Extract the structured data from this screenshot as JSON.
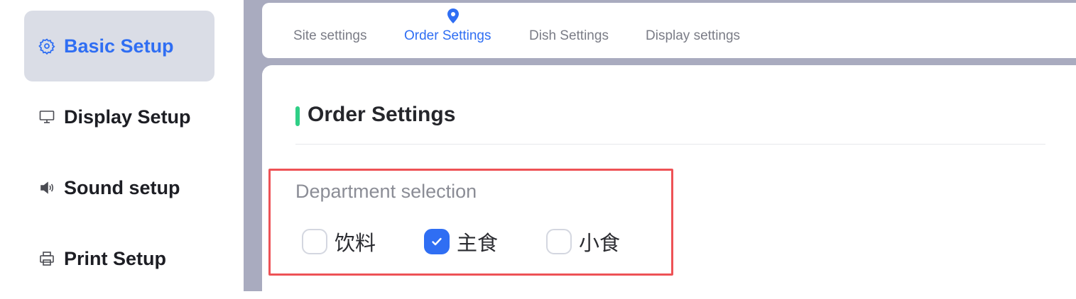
{
  "sidebar": {
    "items": [
      {
        "label": "Basic Setup",
        "icon": "gear-icon",
        "active": true
      },
      {
        "label": "Display Setup",
        "icon": "monitor-icon",
        "active": false
      },
      {
        "label": "Sound setup",
        "icon": "speaker-icon",
        "active": false
      },
      {
        "label": "Print Setup",
        "icon": "printer-icon",
        "active": false
      }
    ]
  },
  "tabs": {
    "items": [
      {
        "label": "Site settings",
        "active": false
      },
      {
        "label": "Order Settings",
        "active": true
      },
      {
        "label": "Dish Settings",
        "active": false
      },
      {
        "label": "Display settings",
        "active": false
      }
    ],
    "active_indicator_icon": "location-pin-icon"
  },
  "section": {
    "title": "Order Settings"
  },
  "department": {
    "label": "Department selection",
    "options": [
      {
        "label": "饮料",
        "checked": false
      },
      {
        "label": "主食",
        "checked": true
      },
      {
        "label": "小食",
        "checked": false
      }
    ]
  },
  "colors": {
    "accent": "#2f6ef3",
    "section_accent": "#2fcf86",
    "highlight_border": "#ee5256",
    "sidebar_active_bg": "#dadde6",
    "background_bar": "#a9abbf"
  }
}
